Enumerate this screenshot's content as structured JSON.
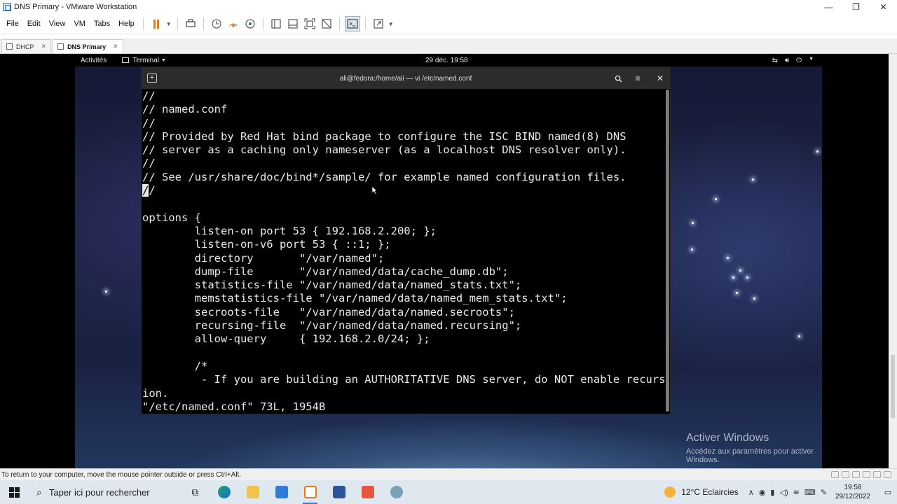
{
  "window": {
    "title": "DNS Primary - VMware Workstation",
    "controls": {
      "minimize": "—",
      "maximize": "❐",
      "close": "✕"
    }
  },
  "menu": {
    "items": [
      "File",
      "Edit",
      "View",
      "VM",
      "Tabs",
      "Help"
    ]
  },
  "tabs": [
    {
      "label": "DHCP",
      "active": false
    },
    {
      "label": "DNS Primary",
      "active": true
    }
  ],
  "guest_topbar": {
    "activities": "Activités",
    "app_menu": "Terminal",
    "clock": "29 déc.  19:58"
  },
  "terminal": {
    "title": "ali@fedora:/home/ali — vi /etc/named.conf",
    "lines": [
      "//",
      "// named.conf",
      "//",
      "// Provided by Red Hat bind package to configure the ISC BIND named(8) DNS",
      "// server as a caching only nameserver (as a localhost DNS resolver only).",
      "//",
      "// See /usr/share/doc/bind*/sample/ for example named configuration files.",
      "__CURSOR__",
      "",
      "options {",
      "        listen-on port 53 { 192.168.2.200; };",
      "        listen-on-v6 port 53 { ::1; };",
      "        directory       \"/var/named\";",
      "        dump-file       \"/var/named/data/cache_dump.db\";",
      "        statistics-file \"/var/named/data/named_stats.txt\";",
      "        memstatistics-file \"/var/named/data/named_mem_stats.txt\";",
      "        secroots-file   \"/var/named/data/named.secroots\";",
      "        recursing-file  \"/var/named/data/named.recursing\";",
      "        allow-query     { 192.168.2.0/24; };",
      "",
      "        /*",
      "         - If you are building an AUTHORITATIVE DNS server, do NOT enable recurs",
      "ion.",
      "\"/etc/named.conf\" 73L, 1954B"
    ],
    "cursor_line": {
      "cursor_char": "/",
      "rest": "/"
    }
  },
  "watermark": {
    "line1": "Activer Windows",
    "line2": "Accédez aux paramètres pour activer Windows."
  },
  "statusbar": {
    "hint": "To return to your computer, move the mouse pointer outside or press Ctrl+Alt."
  },
  "taskbar": {
    "search_placeholder": "Taper ici pour rechercher",
    "weather": "12°C  Eclaircies",
    "time": "19:58",
    "date": "29/12/2022"
  }
}
